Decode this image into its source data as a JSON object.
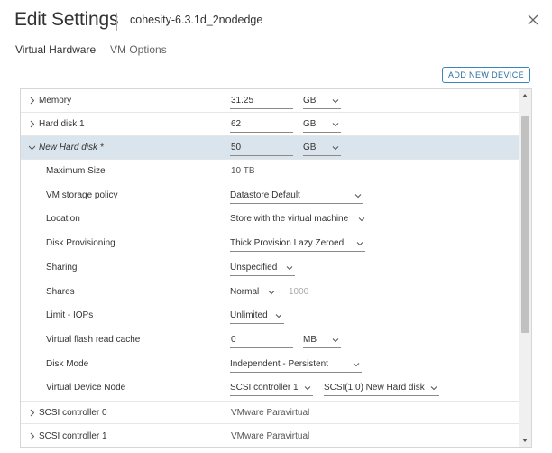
{
  "dialog": {
    "title": "Edit Settings",
    "subtitle": "cohesity-6.3.1d_2nodedge",
    "close_icon": "close-icon"
  },
  "tabs": [
    {
      "label": "Virtual Hardware",
      "active": true
    },
    {
      "label": "VM Options",
      "active": false
    }
  ],
  "add_device_label": "ADD NEW DEVICE",
  "rows": {
    "memory": {
      "label": "Memory",
      "value": "31.25",
      "unit": "GB"
    },
    "hard_disk_1": {
      "label": "Hard disk 1",
      "value": "62",
      "unit": "GB"
    },
    "new_hard_disk": {
      "label": "New Hard disk *",
      "value": "50",
      "unit": "GB"
    },
    "max_size": {
      "label": "Maximum Size",
      "value": "10 TB"
    },
    "storage_policy": {
      "label": "VM storage policy",
      "value": "Datastore Default"
    },
    "location": {
      "label": "Location",
      "value": "Store with the virtual machine"
    },
    "provisioning": {
      "label": "Disk Provisioning",
      "value": "Thick Provision Lazy Zeroed"
    },
    "sharing": {
      "label": "Sharing",
      "value": "Unspecified"
    },
    "shares": {
      "label": "Shares",
      "value": "Normal",
      "number": "1000"
    },
    "limit_iops": {
      "label": "Limit - IOPs",
      "value": "Unlimited"
    },
    "flash_cache": {
      "label": "Virtual flash read cache",
      "value": "0",
      "unit": "MB"
    },
    "disk_mode": {
      "label": "Disk Mode",
      "value": "Independent - Persistent"
    },
    "device_node": {
      "label": "Virtual Device Node",
      "controller": "SCSI controller 1",
      "node": "SCSI(1:0) New Hard disk"
    },
    "scsi_0": {
      "label": "SCSI controller 0",
      "value": "VMware Paravirtual"
    },
    "scsi_1": {
      "label": "SCSI controller 1",
      "value": "VMware Paravirtual"
    }
  },
  "colors": {
    "accent": "#2b6f9f",
    "highlight_row": "#d9e4ec"
  }
}
